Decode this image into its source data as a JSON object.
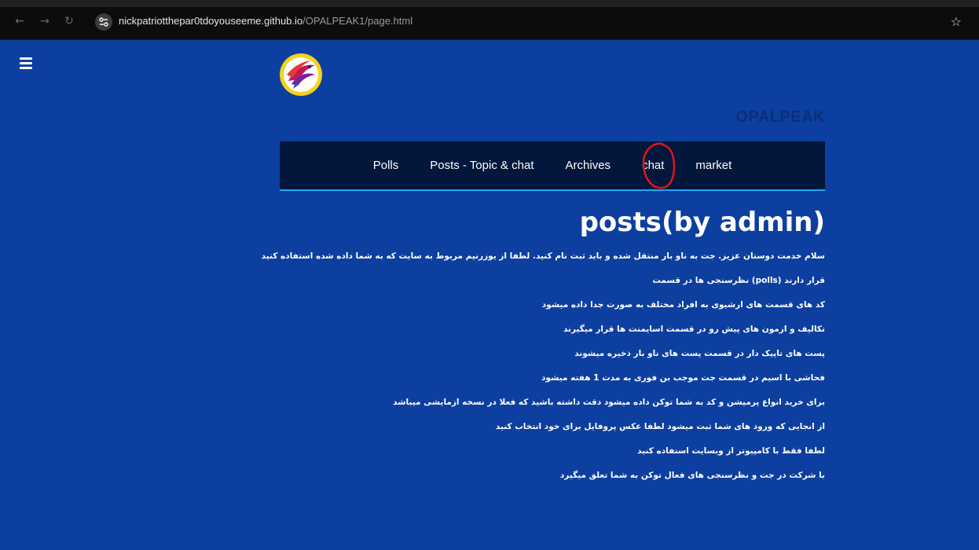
{
  "browser": {
    "url_domain": "nickpatriotthepar0tdoyouseeme.github.io",
    "url_path": "/OPALPEAK1/page.html",
    "back_icon": "arrow-left-icon",
    "forward_icon": "arrow-right-icon",
    "reload_icon": "reload-icon",
    "bookmark_icon": "star-icon"
  },
  "page": {
    "brand": "OPALPEAK",
    "menu_icon": "hamburger-icon",
    "nav": [
      {
        "label": "Polls"
      },
      {
        "label": "Posts - Topic & chat"
      },
      {
        "label": "Archives"
      },
      {
        "label": "chat"
      },
      {
        "label": "market"
      }
    ],
    "heading": "posts(by admin)",
    "posts": [
      "سلام خدمت دوستان عزیز. جت به ناو بار منتقل شده و باید ثبت نام کنید. لطفا از یوزرنیم مربوط به سایت که به شما داده شده استفاده کنید",
      "قرار دارند (polls) نظرسنجی ها در قسمت",
      "کد های قسمت های ارشیوی به افراد مختلف به صورت جدا داده میشود",
      "تکالیف و ازمون های پیش رو در قسمت اسایمنت ها قرار میگیرند",
      "پست های تاپیک دار در قسمت پست های ناو بار ذخیره میشوند",
      "فحاشی با اسیم در قسمت جت موجب بن فوری به مدت 1 هفته میشود",
      "برای خرید انواع پرمیشن و کد به شما توکن داده میشود دقت داشته باشید که فعلا در نسخه ازمایشی میباشد",
      "از انجایی که ورود های شما ثبت میشود لطفا عکس پروفایل برای خود انتخاب کنید",
      "لطفا فقط با کامپیوتر از وبسایت استفاده کنید",
      "با شرکت در جت و نظرسنجی های فعال توکن به شما تعلق میگیرد"
    ]
  },
  "colors": {
    "page_bg": "#0d3fa0",
    "navbar_bg": "#02173b",
    "navbar_border": "#1fa6ff",
    "annotation": "#e0151b"
  }
}
